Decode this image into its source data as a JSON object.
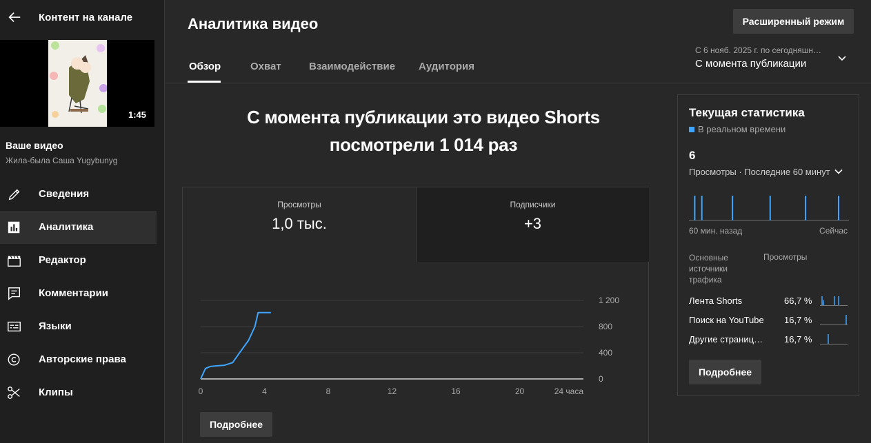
{
  "sidebar": {
    "title": "Контент на канале",
    "thumbnail_duration": "1:45",
    "your_video_label": "Ваше видео",
    "video_title": "Жила-была Саша Yugybunyg",
    "items": [
      {
        "label": "Сведения",
        "icon": "pencil-icon",
        "active": false
      },
      {
        "label": "Аналитика",
        "icon": "analytics-icon",
        "active": true
      },
      {
        "label": "Редактор",
        "icon": "clapperboard-icon",
        "active": false
      },
      {
        "label": "Комментарии",
        "icon": "comment-icon",
        "active": false
      },
      {
        "label": "Языки",
        "icon": "subtitles-icon",
        "active": false
      },
      {
        "label": "Авторские права",
        "icon": "copyright-icon",
        "active": false
      },
      {
        "label": "Клипы",
        "icon": "scissors-icon",
        "active": false
      }
    ]
  },
  "header": {
    "title": "Аналитика видео",
    "advanced_button": "Расширенный режим",
    "tabs": [
      {
        "label": "Обзор",
        "active": true
      },
      {
        "label": "Охват",
        "active": false
      },
      {
        "label": "Взаимодействие",
        "active": false
      },
      {
        "label": "Аудитория",
        "active": false
      }
    ],
    "date_range_text": "С 6 нояб. 2025 г. по сегодняшн…",
    "date_range_label": "С момента публикации"
  },
  "overview": {
    "headline_line1": "С момента публикации это видео Shorts",
    "headline_line2": "посмотрели 1 014 раз",
    "metrics": [
      {
        "label": "Просмотры",
        "value": "1,0 тыс."
      },
      {
        "label": "Подписчики",
        "value": "+3"
      }
    ],
    "more_button": "Подробнее"
  },
  "chart_data": {
    "type": "line",
    "x_unit_label": "24 часа",
    "x_ticks": [
      "0",
      "4",
      "8",
      "12",
      "16",
      "20",
      "24 часа"
    ],
    "y_ticks": [
      "0",
      "400",
      "800",
      "1 200"
    ],
    "xlim": [
      0,
      24
    ],
    "ylim": [
      0,
      1200
    ],
    "series": [
      {
        "color": "#3ea6ff",
        "x": [
          0,
          0.3,
          0.6,
          1,
          1.5,
          2,
          2.5,
          3,
          3.4,
          3.6,
          4,
          4.4
        ],
        "y": [
          0,
          160,
          190,
          200,
          210,
          250,
          420,
          590,
          800,
          1014,
          1014,
          1014
        ]
      },
      {
        "color": "#aaaaaa",
        "x": [
          0,
          24
        ],
        "y": [
          0,
          0
        ]
      }
    ]
  },
  "realtime": {
    "title": "Текущая статистика",
    "live_label": "В реальном времени",
    "count": "6",
    "metric_label": "Просмотры · Последние 60 минут",
    "axis_left": "60 мин. назад",
    "axis_right": "Сейчас",
    "bar_minutes": [
      1,
      4,
      17,
      33,
      48,
      62
    ],
    "traffic_header_source": "Основные источники трафика",
    "traffic_header_views": "Просмотры",
    "sources": [
      {
        "name": "Лента Shorts",
        "pct": "66,7 %"
      },
      {
        "name": "Поиск на YouTube",
        "pct": "16,7 %"
      },
      {
        "name": "Другие страниц…",
        "pct": "16,7 %"
      }
    ],
    "more_button": "Подробнее",
    "accent": "#3ea6ff"
  }
}
